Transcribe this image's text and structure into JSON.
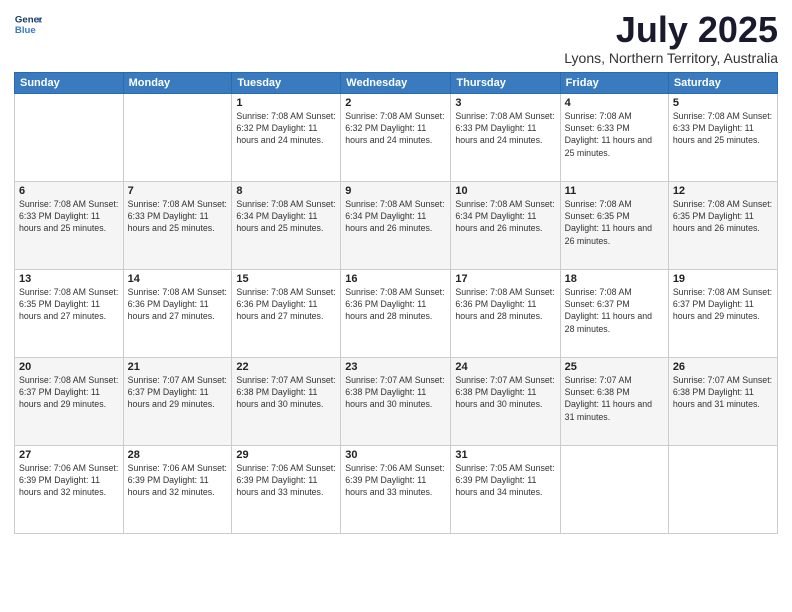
{
  "header": {
    "logo_line1": "General",
    "logo_line2": "Blue",
    "month": "July 2025",
    "location": "Lyons, Northern Territory, Australia"
  },
  "days_of_week": [
    "Sunday",
    "Monday",
    "Tuesday",
    "Wednesday",
    "Thursday",
    "Friday",
    "Saturday"
  ],
  "weeks": [
    [
      {
        "day": "",
        "info": ""
      },
      {
        "day": "",
        "info": ""
      },
      {
        "day": "1",
        "info": "Sunrise: 7:08 AM\nSunset: 6:32 PM\nDaylight: 11 hours and 24 minutes."
      },
      {
        "day": "2",
        "info": "Sunrise: 7:08 AM\nSunset: 6:32 PM\nDaylight: 11 hours and 24 minutes."
      },
      {
        "day": "3",
        "info": "Sunrise: 7:08 AM\nSunset: 6:33 PM\nDaylight: 11 hours and 24 minutes."
      },
      {
        "day": "4",
        "info": "Sunrise: 7:08 AM\nSunset: 6:33 PM\nDaylight: 11 hours and 25 minutes."
      },
      {
        "day": "5",
        "info": "Sunrise: 7:08 AM\nSunset: 6:33 PM\nDaylight: 11 hours and 25 minutes."
      }
    ],
    [
      {
        "day": "6",
        "info": "Sunrise: 7:08 AM\nSunset: 6:33 PM\nDaylight: 11 hours and 25 minutes."
      },
      {
        "day": "7",
        "info": "Sunrise: 7:08 AM\nSunset: 6:33 PM\nDaylight: 11 hours and 25 minutes."
      },
      {
        "day": "8",
        "info": "Sunrise: 7:08 AM\nSunset: 6:34 PM\nDaylight: 11 hours and 25 minutes."
      },
      {
        "day": "9",
        "info": "Sunrise: 7:08 AM\nSunset: 6:34 PM\nDaylight: 11 hours and 26 minutes."
      },
      {
        "day": "10",
        "info": "Sunrise: 7:08 AM\nSunset: 6:34 PM\nDaylight: 11 hours and 26 minutes."
      },
      {
        "day": "11",
        "info": "Sunrise: 7:08 AM\nSunset: 6:35 PM\nDaylight: 11 hours and 26 minutes."
      },
      {
        "day": "12",
        "info": "Sunrise: 7:08 AM\nSunset: 6:35 PM\nDaylight: 11 hours and 26 minutes."
      }
    ],
    [
      {
        "day": "13",
        "info": "Sunrise: 7:08 AM\nSunset: 6:35 PM\nDaylight: 11 hours and 27 minutes."
      },
      {
        "day": "14",
        "info": "Sunrise: 7:08 AM\nSunset: 6:36 PM\nDaylight: 11 hours and 27 minutes."
      },
      {
        "day": "15",
        "info": "Sunrise: 7:08 AM\nSunset: 6:36 PM\nDaylight: 11 hours and 27 minutes."
      },
      {
        "day": "16",
        "info": "Sunrise: 7:08 AM\nSunset: 6:36 PM\nDaylight: 11 hours and 28 minutes."
      },
      {
        "day": "17",
        "info": "Sunrise: 7:08 AM\nSunset: 6:36 PM\nDaylight: 11 hours and 28 minutes."
      },
      {
        "day": "18",
        "info": "Sunrise: 7:08 AM\nSunset: 6:37 PM\nDaylight: 11 hours and 28 minutes."
      },
      {
        "day": "19",
        "info": "Sunrise: 7:08 AM\nSunset: 6:37 PM\nDaylight: 11 hours and 29 minutes."
      }
    ],
    [
      {
        "day": "20",
        "info": "Sunrise: 7:08 AM\nSunset: 6:37 PM\nDaylight: 11 hours and 29 minutes."
      },
      {
        "day": "21",
        "info": "Sunrise: 7:07 AM\nSunset: 6:37 PM\nDaylight: 11 hours and 29 minutes."
      },
      {
        "day": "22",
        "info": "Sunrise: 7:07 AM\nSunset: 6:38 PM\nDaylight: 11 hours and 30 minutes."
      },
      {
        "day": "23",
        "info": "Sunrise: 7:07 AM\nSunset: 6:38 PM\nDaylight: 11 hours and 30 minutes."
      },
      {
        "day": "24",
        "info": "Sunrise: 7:07 AM\nSunset: 6:38 PM\nDaylight: 11 hours and 30 minutes."
      },
      {
        "day": "25",
        "info": "Sunrise: 7:07 AM\nSunset: 6:38 PM\nDaylight: 11 hours and 31 minutes."
      },
      {
        "day": "26",
        "info": "Sunrise: 7:07 AM\nSunset: 6:38 PM\nDaylight: 11 hours and 31 minutes."
      }
    ],
    [
      {
        "day": "27",
        "info": "Sunrise: 7:06 AM\nSunset: 6:39 PM\nDaylight: 11 hours and 32 minutes."
      },
      {
        "day": "28",
        "info": "Sunrise: 7:06 AM\nSunset: 6:39 PM\nDaylight: 11 hours and 32 minutes."
      },
      {
        "day": "29",
        "info": "Sunrise: 7:06 AM\nSunset: 6:39 PM\nDaylight: 11 hours and 33 minutes."
      },
      {
        "day": "30",
        "info": "Sunrise: 7:06 AM\nSunset: 6:39 PM\nDaylight: 11 hours and 33 minutes."
      },
      {
        "day": "31",
        "info": "Sunrise: 7:05 AM\nSunset: 6:39 PM\nDaylight: 11 hours and 34 minutes."
      },
      {
        "day": "",
        "info": ""
      },
      {
        "day": "",
        "info": ""
      }
    ]
  ]
}
